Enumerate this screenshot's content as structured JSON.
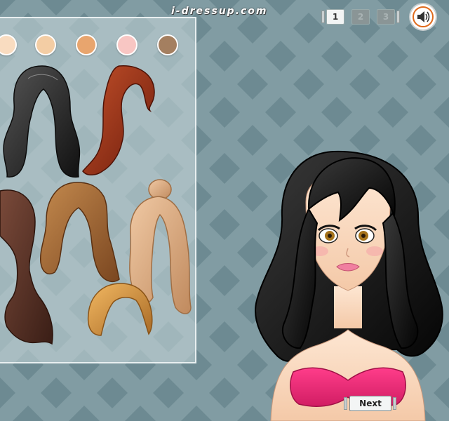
{
  "site": {
    "logo_text": "i-dressup.com"
  },
  "pagination": {
    "pages": [
      {
        "label": "1",
        "active": true
      },
      {
        "label": "2",
        "active": false
      },
      {
        "label": "3",
        "active": false
      }
    ]
  },
  "sound": {
    "icon": "speaker-icon"
  },
  "skin_swatches": [
    "#f9dcc0",
    "#f3cda4",
    "#e8a56e",
    "#f8c6c3",
    "#a47f60"
  ],
  "hair_options": [
    {
      "color": "black",
      "style": "long wavy"
    },
    {
      "color": "auburn",
      "style": "side swept"
    },
    {
      "color": "dark brown",
      "style": "ponytail"
    },
    {
      "color": "chestnut",
      "style": "wavy"
    },
    {
      "color": "blonde",
      "style": "top knot"
    },
    {
      "color": "golden blonde",
      "style": "short bob"
    }
  ],
  "controls": {
    "next_label": "Next"
  },
  "colors": {
    "background": "#7f9ba2",
    "diamond": "#6f8c94",
    "panel": "#c7d6d9",
    "top_bar": "#d2220d"
  }
}
